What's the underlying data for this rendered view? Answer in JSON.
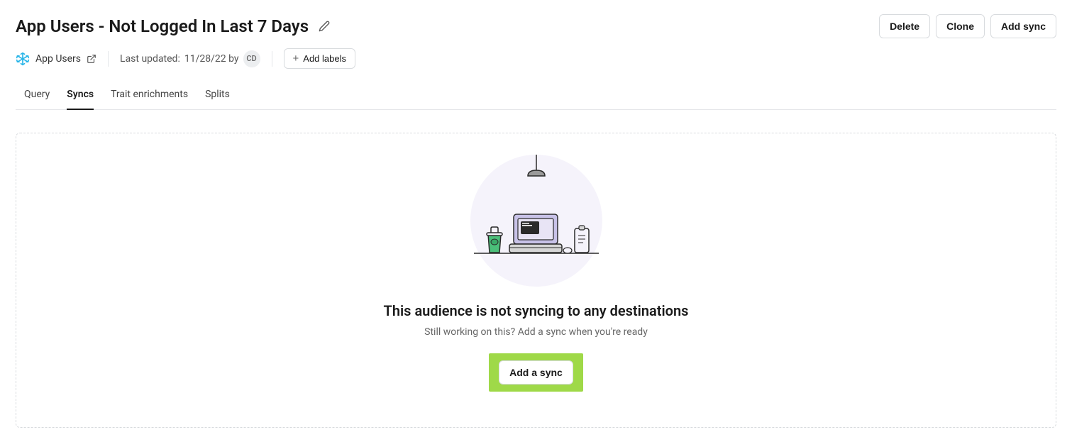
{
  "header": {
    "title": "App Users - Not Logged In Last 7 Days",
    "actions": {
      "delete": "Delete",
      "clone": "Clone",
      "add_sync": "Add sync"
    }
  },
  "meta": {
    "parent_name": "App Users",
    "last_updated_prefix": "Last updated:",
    "last_updated_value": "11/28/22 by",
    "avatar_initials": "CD",
    "add_labels": "Add labels"
  },
  "tabs": [
    {
      "label": "Query",
      "active": false
    },
    {
      "label": "Syncs",
      "active": true
    },
    {
      "label": "Trait enrichments",
      "active": false
    },
    {
      "label": "Splits",
      "active": false
    }
  ],
  "empty_state": {
    "title": "This audience is not syncing to any destinations",
    "subtitle": "Still working on this? Add a sync when you're ready",
    "cta": "Add a sync"
  },
  "icons": {
    "edit": "edit-icon",
    "snowflake": "snowflake-icon",
    "external": "external-link-icon",
    "plus": "plus-icon"
  }
}
